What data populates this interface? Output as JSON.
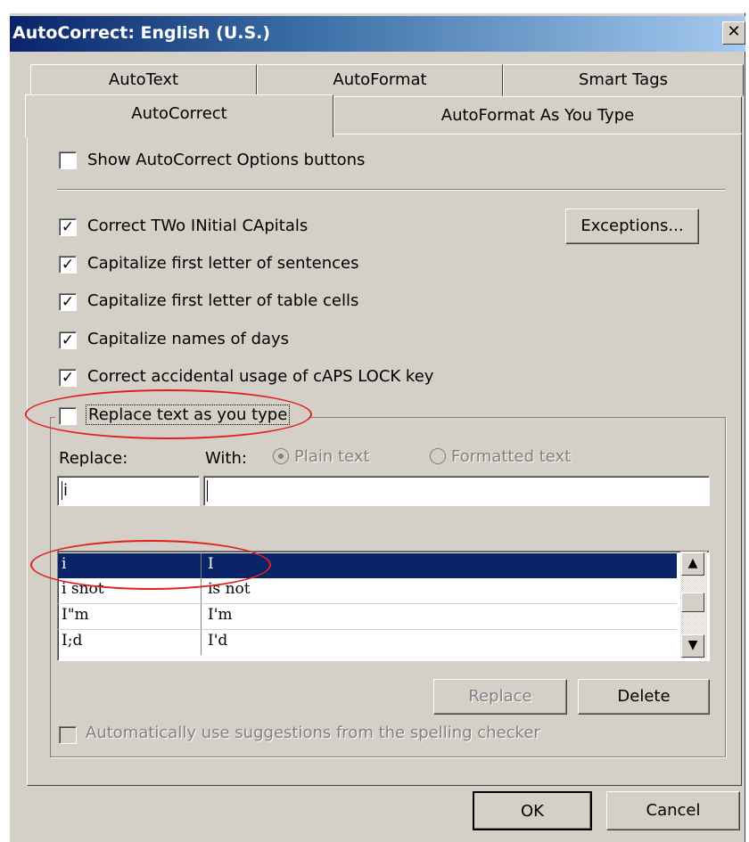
{
  "window": {
    "title": "AutoCorrect: English (U.S.)",
    "close_glyph": "✕"
  },
  "tabs": {
    "row1": [
      "AutoText",
      "AutoFormat",
      "Smart Tags"
    ],
    "row2": [
      "AutoCorrect",
      "AutoFormat As You Type"
    ],
    "active": "AutoCorrect"
  },
  "options": {
    "show_buttons": {
      "label": "Show AutoCorrect Options buttons",
      "checked": false
    },
    "correct_two": {
      "label": "Correct TWo INitial CApitals",
      "checked": true
    },
    "cap_sentences": {
      "label": "Capitalize first letter of sentences",
      "checked": true
    },
    "cap_table": {
      "label": "Capitalize first letter of table cells",
      "checked": true
    },
    "cap_days": {
      "label": "Capitalize names of days",
      "checked": true
    },
    "caps_lock": {
      "label": "Correct accidental usage of cAPS LOCK key",
      "checked": true
    },
    "replace_text": {
      "label": "Replace text as you type",
      "checked": false
    }
  },
  "exceptions_button": "Exceptions...",
  "replace_section": {
    "replace_label": "Replace:",
    "with_label": "With:",
    "plain_text": "Plain text",
    "formatted_text": "Formatted text",
    "replace_value": "i",
    "with_value": ""
  },
  "list": {
    "rows": [
      {
        "from": "i",
        "to": "I",
        "selected": true
      },
      {
        "from": "i snot",
        "to": "is not",
        "selected": false
      },
      {
        "from": "I\"m",
        "to": "I'm",
        "selected": false
      },
      {
        "from": "I;d",
        "to": "I'd",
        "selected": false
      }
    ]
  },
  "buttons": {
    "replace": "Replace",
    "delete": "Delete",
    "ok": "OK",
    "cancel": "Cancel"
  },
  "suggestions": {
    "label": "Automatically use suggestions from the spelling checker",
    "checked": false
  },
  "annotation_color": "#e02020"
}
